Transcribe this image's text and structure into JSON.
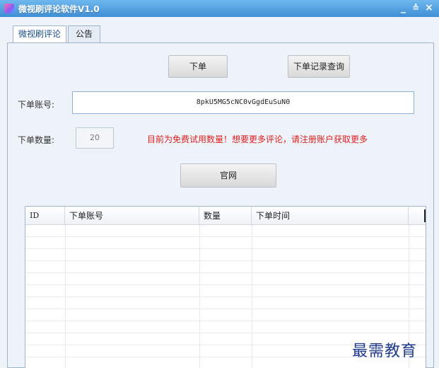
{
  "window": {
    "title": "微视刷评论软件V1.0",
    "icon": "app-icon",
    "controls": {
      "minimize": "_",
      "maximize": "≙",
      "close": "×"
    }
  },
  "tabs": [
    {
      "label": "微视刷评论",
      "active": true
    },
    {
      "label": "公告",
      "active": false
    }
  ],
  "buttons": {
    "order": "下单",
    "query": "下单记录查询",
    "site": "官网"
  },
  "form": {
    "account_label": "下单账号:",
    "account_value": "8pkU5MG5cNC0vGgdEuSuN0",
    "qty_label": "下单数量:",
    "qty_value": "20",
    "notice": "目前为免费试用数量！想要更多评论，请注册账户获取更多"
  },
  "table": {
    "columns": [
      "ID",
      "下单账号",
      "数量",
      "下单时间"
    ],
    "rows": []
  },
  "watermark": "最需教育",
  "colors": {
    "titlebar": "#3f8fd6",
    "notice": "#e02020",
    "watermark": "#1f3a8a"
  }
}
